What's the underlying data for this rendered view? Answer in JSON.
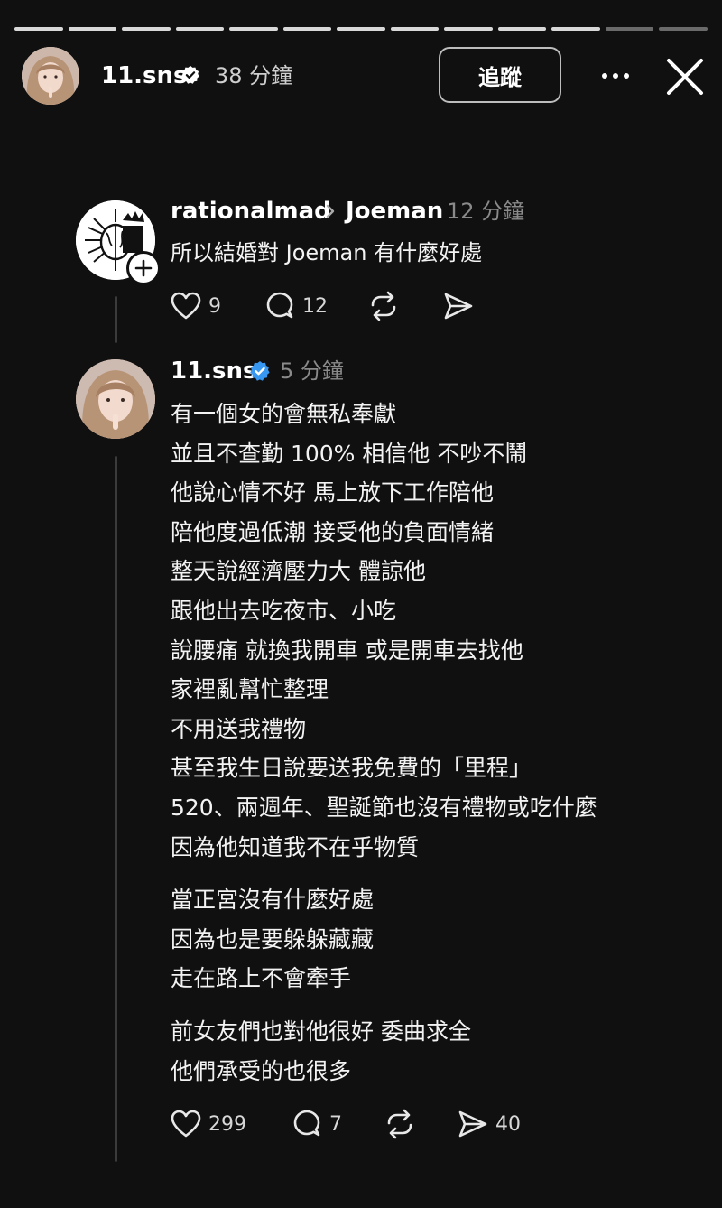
{
  "story": {
    "segments_total": 13,
    "segments_done": 11,
    "user": "11.sns",
    "time": "38 分鐘",
    "follow_label": "追蹤",
    "icons": {
      "more": "more-icon",
      "close": "close-icon",
      "verified": "verified-badge-icon"
    }
  },
  "post1": {
    "username": "rationalmad",
    "reply_to": "Joeman",
    "time": "12 分鐘",
    "text": "所以結婚對 Joeman 有什麼好處",
    "likes": "9",
    "comments": "12",
    "icons": [
      "heart-icon",
      "comment-icon",
      "repost-icon",
      "share-icon"
    ]
  },
  "post2": {
    "username": "11.sns",
    "time": "5 分鐘",
    "paragraphs": [
      [
        "有一個女的會無私奉獻",
        "並且不查勤 100% 相信他 不吵不鬧",
        "他說心情不好 馬上放下工作陪他",
        "陪他度過低潮 接受他的負面情緒",
        "整天說經濟壓力大 體諒他",
        "跟他出去吃夜市、小吃",
        "說腰痛 就換我開車 或是開車去找他",
        "家裡亂幫忙整理",
        "不用送我禮物",
        "甚至我生日說要送我免費的「里程」",
        "520、兩週年、聖誕節也沒有禮物或吃什麼",
        "因為他知道我不在乎物質"
      ],
      [
        "當正宮沒有什麼好處",
        "因為也是要躲躲藏藏",
        "走在路上不會牽手"
      ],
      [
        "前女友們也對他很好 委曲求全",
        "他們承受的也很多"
      ]
    ],
    "likes": "299",
    "comments": "7",
    "shares": "40"
  },
  "colors": {
    "background": "#101010",
    "text": "#f3f3f3",
    "muted": "#8a8a8a",
    "verified": "#3897f0",
    "thread_line": "#3b3b3b"
  }
}
